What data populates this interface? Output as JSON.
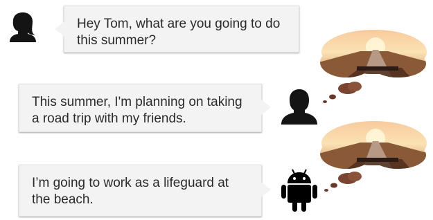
{
  "messages": [
    {
      "speaker": "woman",
      "text": "Hey Tom, what are you going to do this summer?"
    },
    {
      "speaker": "man",
      "text": "This summer, I'm planning on taking a road trip with my friends."
    },
    {
      "speaker": "android",
      "text": "I’m going to work as a lifeguard at the beach."
    }
  ],
  "icons": {
    "woman": "woman-silhouette-icon",
    "man": "man-silhouette-icon",
    "android": "android-robot-icon",
    "thought": "road-trip-thought-cloud"
  }
}
